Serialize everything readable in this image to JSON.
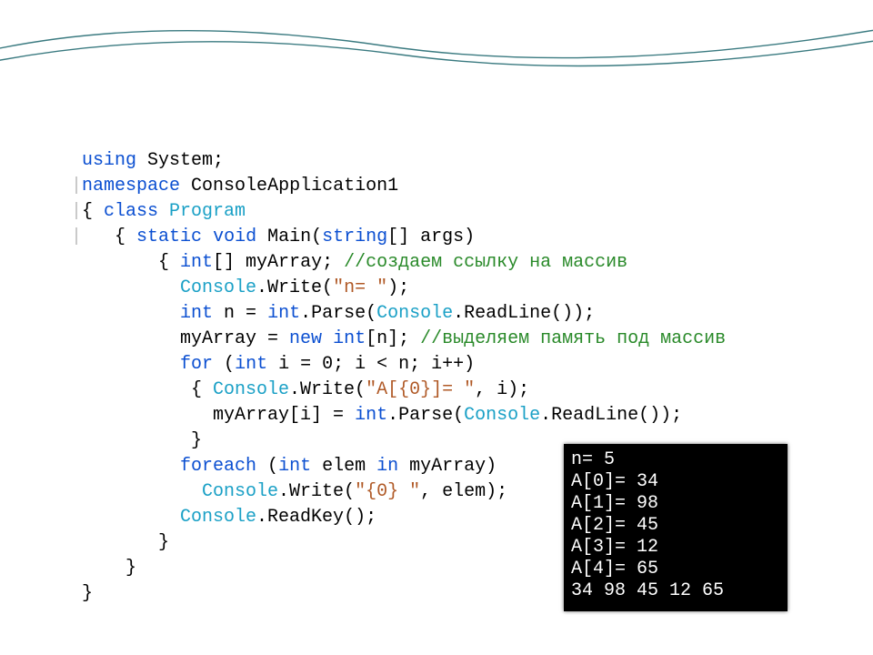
{
  "code": {
    "l1_kw": "using",
    "l1_rest": " System;",
    "l2_bar": "|",
    "l2_kw": "namespace",
    "l2_name": " ConsoleApplication1",
    "l3_bar": "|",
    "l3_brace": "{ ",
    "l3_kw": "class",
    "l3_name": " Program",
    "l4_bar": "|",
    "l4_sp": "   { ",
    "l4_kw1": "static",
    "l4_sp2": " ",
    "l4_kw2": "void",
    "l4_rest": " Main(",
    "l4_kw3": "string",
    "l4_rest2": "[] args)",
    "l5_indent": "        { ",
    "l5_kw": "int",
    "l5_rest": "[] myArray; ",
    "l5_com": "//создаем ссылку на массив",
    "l6_indent": "          ",
    "l6_type": "Console",
    "l6_rest": ".Write(",
    "l6_str": "\"n= \"",
    "l6_rest2": ");",
    "l7_indent": "          ",
    "l7_kw": "int",
    "l7_rest": " n = ",
    "l7_kw2": "int",
    "l7_rest2": ".Parse(",
    "l7_type": "Console",
    "l7_rest3": ".ReadLine());",
    "l8_indent": "          myArray = ",
    "l8_kw": "new",
    "l8_sp": " ",
    "l8_kw2": "int",
    "l8_rest": "[n]; ",
    "l8_com": "//выделяем память под массив",
    "l9_indent": "          ",
    "l9_kw": "for",
    "l9_rest": " (",
    "l9_kw2": "int",
    "l9_rest2": " i = 0; i < n; i++)",
    "l10_indent": "           { ",
    "l10_type": "Console",
    "l10_rest": ".Write(",
    "l10_str": "\"A[{0}]= \"",
    "l10_rest2": ", i);",
    "l11_indent": "             myArray[i] = ",
    "l11_kw": "int",
    "l11_rest": ".Parse(",
    "l11_type": "Console",
    "l11_rest2": ".ReadLine());",
    "l12_indent": "           }",
    "l13_indent": "          ",
    "l13_kw": "foreach",
    "l13_rest": " (",
    "l13_kw2": "int",
    "l13_rest2": " elem ",
    "l13_kw3": "in",
    "l13_rest3": " myArray)",
    "l14_indent": "            ",
    "l14_type": "Console",
    "l14_rest": ".Write(",
    "l14_str": "\"{0} \"",
    "l14_rest2": ", elem);",
    "l15_indent": "          ",
    "l15_type": "Console",
    "l15_rest": ".ReadKey();",
    "l16_indent": "        }",
    "l17_indent": "     }",
    "l18_indent": " }"
  },
  "console": {
    "l1": "n= 5",
    "l2": "A[0]= 34",
    "l3": "A[1]= 98",
    "l4": "A[2]= 45",
    "l5": "A[3]= 12",
    "l6": "A[4]= 65",
    "l7": "34 98 45 12 65"
  }
}
